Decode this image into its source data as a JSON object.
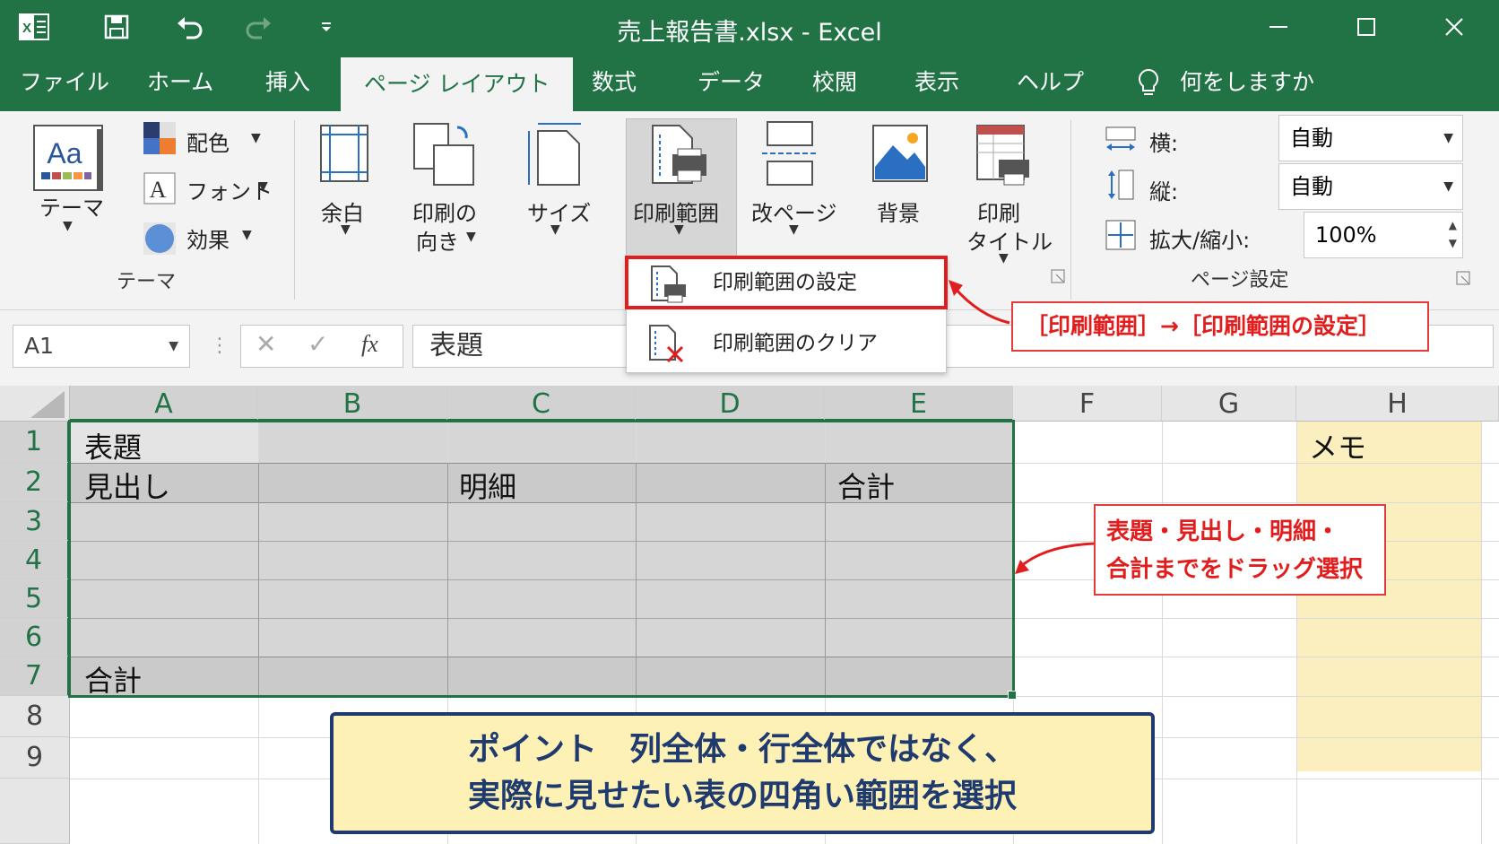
{
  "window": {
    "title": "売上報告書.xlsx  -  Excel"
  },
  "tabs": [
    {
      "label": "ファイル"
    },
    {
      "label": "ホーム"
    },
    {
      "label": "挿入"
    },
    {
      "label": "ページ レイアウト"
    },
    {
      "label": "数式"
    },
    {
      "label": "データ"
    },
    {
      "label": "校閲"
    },
    {
      "label": "表示"
    },
    {
      "label": "ヘルプ"
    }
  ],
  "tell_me": "何をしますか",
  "ribbon": {
    "theme": {
      "label": "テーマ",
      "colors": "配色",
      "fonts": "フォント",
      "effects": "効果",
      "group": "テーマ"
    },
    "margins": "余白",
    "orientation": [
      "印刷の",
      "向き"
    ],
    "size": "サイズ",
    "print_area": "印刷範囲",
    "breaks": "改ページ",
    "background": "背景",
    "print_titles": [
      "印刷",
      "タイトル"
    ],
    "scale": {
      "width_label": "横:",
      "width_value": "自動",
      "height_label": "縦:",
      "height_value": "自動",
      "scale_label": "拡大/縮小:",
      "scale_value": "100%",
      "group": "ページ設定"
    }
  },
  "dropdown": {
    "set_print_area": "印刷範囲の設定",
    "clear_print_area": "印刷範囲のクリア"
  },
  "formula_bar": {
    "name_box": "A1",
    "fx": "fx",
    "content": "表題"
  },
  "grid": {
    "columns": [
      "A",
      "B",
      "C",
      "D",
      "E",
      "F",
      "G",
      "H"
    ],
    "rows": [
      "1",
      "2",
      "3",
      "4",
      "5",
      "6",
      "7",
      "8",
      "9"
    ],
    "cells": {
      "A1": "表題",
      "A2": "見出し",
      "C2": "明細",
      "E2": "合計",
      "A7": "合計",
      "H1": "メモ"
    }
  },
  "callouts": {
    "menu": "［印刷範囲］→［印刷範囲の設定］",
    "drag": [
      "表題・見出し・明細・",
      "合計までをドラッグ選択"
    ]
  },
  "note": {
    "line1": "ポイント　列全体・行全体ではなく、",
    "line2": "実際に見せたい表の四角い範囲を選択"
  },
  "colors": {
    "excel_green": "#217346",
    "highlight_red": "#e21d1d",
    "note_bg": "#fdf1b6",
    "note_border": "#1f3a6e",
    "memo_bg": "#fcefbf"
  }
}
